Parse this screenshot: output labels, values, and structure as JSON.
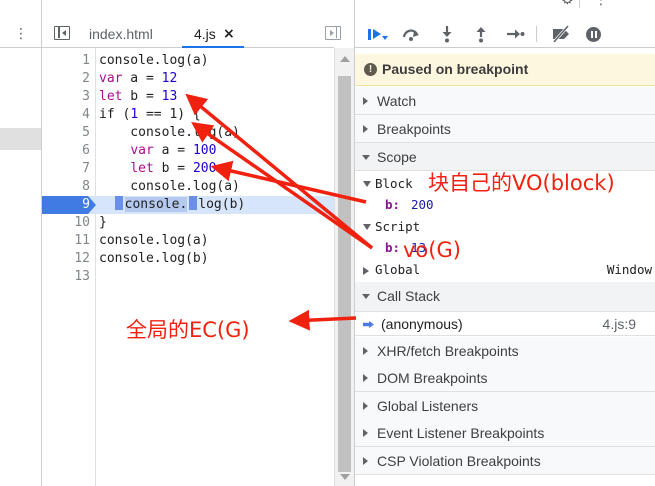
{
  "navigator": {
    "menu_glyph": "⋮"
  },
  "tabs": [
    {
      "label": "index.html"
    },
    {
      "label": "4.js",
      "close_glyph": "×"
    }
  ],
  "code_lines": [
    {
      "num": "1",
      "text": "console.log(a)"
    },
    {
      "num": "2",
      "kw": "var",
      "rest": " a = ",
      "n": "12"
    },
    {
      "num": "3",
      "kw": "let",
      "rest": " b = ",
      "n": "13"
    },
    {
      "num": "4",
      "pre": "if (",
      "n": "1",
      "post": " == 1) {"
    },
    {
      "num": "5",
      "text": "    console.log(a)"
    },
    {
      "num": "6",
      "kw": "var",
      "indent": "    ",
      "rest": " a = ",
      "n": "100"
    },
    {
      "num": "7",
      "kw": "let",
      "indent": "    ",
      "rest": " b = ",
      "n": "200"
    },
    {
      "num": "8",
      "text": "    console.log(a)"
    },
    {
      "num": "9",
      "sel": "console.",
      "rest": "log(b)"
    },
    {
      "num": "10",
      "text": "}"
    },
    {
      "num": "11",
      "text": "console.log(a)"
    },
    {
      "num": "12",
      "text": "console.log(b)"
    },
    {
      "num": "13",
      "text": ""
    }
  ],
  "current_line": "9",
  "debugger": {
    "paused_message": "Paused on breakpoint",
    "info_glyph": "!",
    "sections": {
      "watch": "Watch",
      "breakpoints": "Breakpoints",
      "scope": "Scope",
      "call_stack": "Call Stack",
      "xhr": "XHR/fetch Breakpoints",
      "dom": "DOM Breakpoints",
      "global_listeners": "Global Listeners",
      "event_listener": "Event Listener Breakpoints",
      "csp": "CSP Violation Breakpoints"
    },
    "scope": {
      "block": {
        "label": "Block",
        "var": "b:",
        "value": "200"
      },
      "script": {
        "label": "Script",
        "var": "b:",
        "value": "13"
      },
      "global": {
        "label": "Global",
        "value": "Window"
      }
    },
    "call_stack": {
      "fn": "(anonymous)",
      "location": "4.js:9"
    }
  },
  "annotations": {
    "block_vo": "块自己的VO(block)",
    "vo_g": "vo(G)",
    "global_ec": "全局的EC(G)",
    "color": "#f0220f"
  },
  "colors": {
    "accent": "#1a73e8",
    "keyword": "#aa0d91",
    "number": "#1c00cf",
    "paused_banner": "#fef7e0",
    "current_line": "#d7e5fb"
  }
}
